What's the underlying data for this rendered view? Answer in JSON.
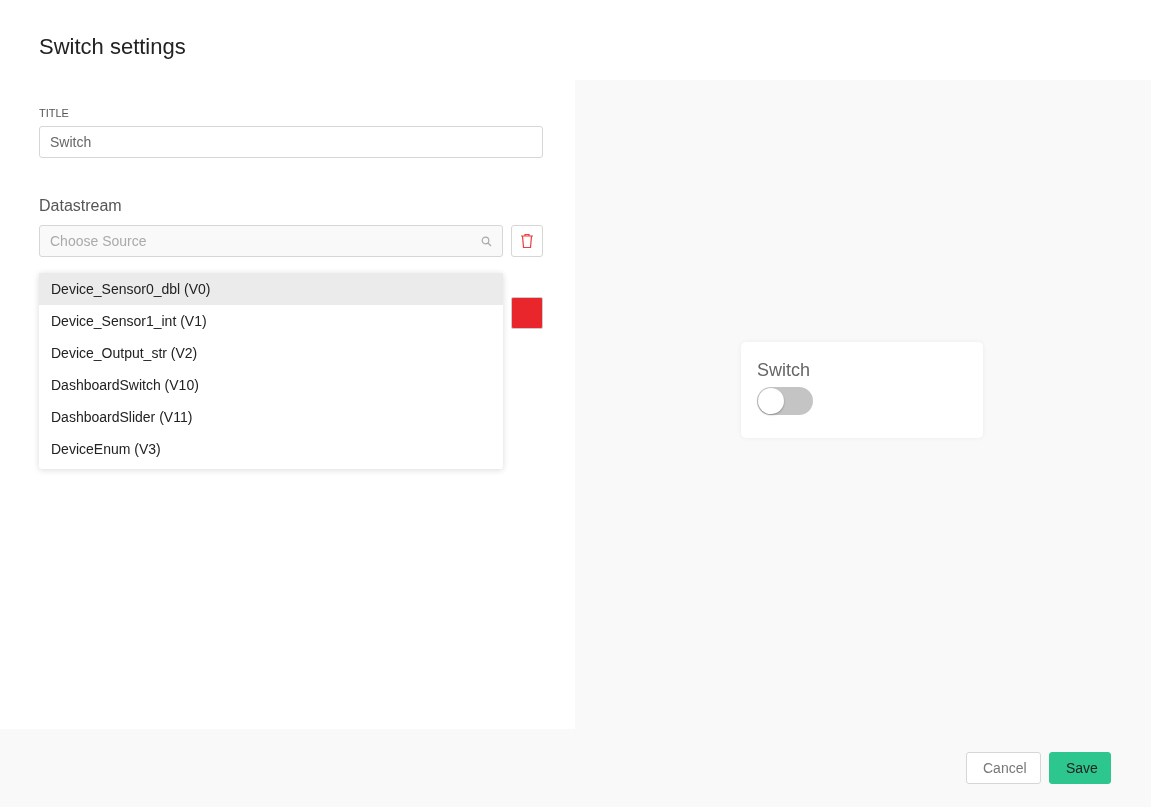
{
  "dialog": {
    "title": "Switch settings"
  },
  "title_field": {
    "label": "TITLE",
    "value": "Switch"
  },
  "datastream": {
    "heading": "Datastream",
    "placeholder": "Choose Source",
    "options": [
      {
        "label": "Device_Sensor0_dbl (V0)",
        "selected": true
      },
      {
        "label": "Device_Sensor1_int (V1)",
        "selected": false
      },
      {
        "label": "Device_Output_str (V2)",
        "selected": false
      },
      {
        "label": "DashboardSwitch (V10)",
        "selected": false
      },
      {
        "label": "DashboardSlider (V11)",
        "selected": false
      },
      {
        "label": "DeviceEnum (V3)",
        "selected": false
      }
    ]
  },
  "color_swatch": {
    "color": "#e8262b"
  },
  "preview": {
    "title": "Switch",
    "on": false
  },
  "buttons": [
    {
      "label": "Cancel",
      "kind": "secondary"
    },
    {
      "label": "Save",
      "kind": "primary"
    }
  ]
}
